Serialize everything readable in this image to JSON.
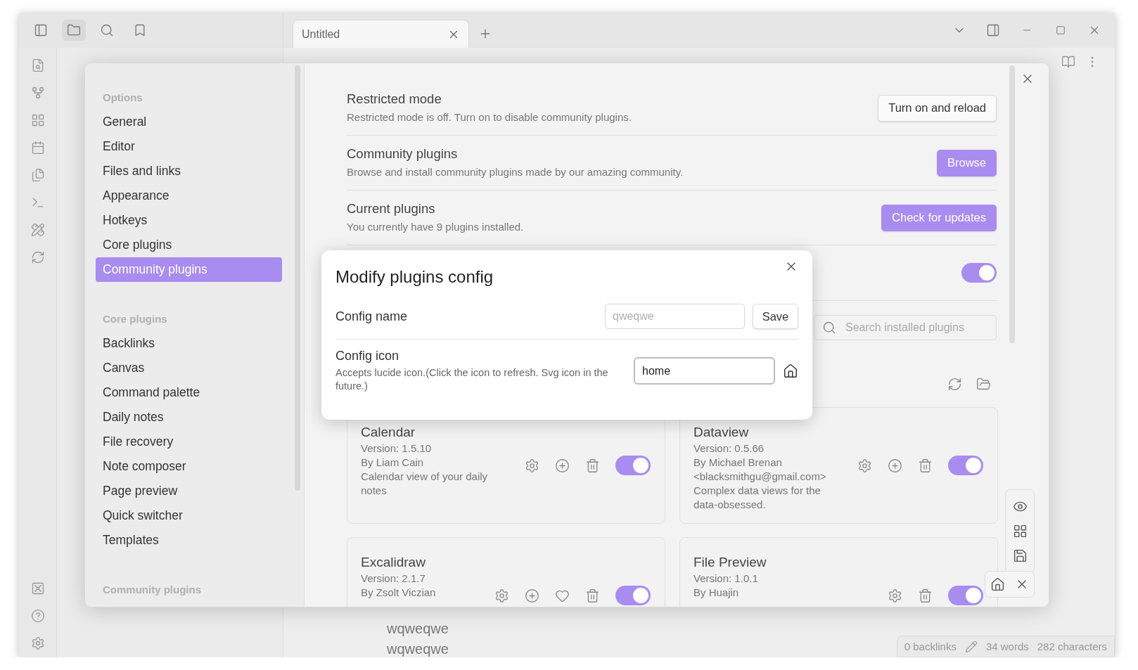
{
  "title_bar": {
    "tabs": [
      {
        "label": "Untitled",
        "selected": true
      }
    ]
  },
  "settings": {
    "nav": [
      {
        "heading": "Options",
        "items": [
          {
            "label": "General",
            "selected": false
          },
          {
            "label": "Editor",
            "selected": false
          },
          {
            "label": "Files and links",
            "selected": false
          },
          {
            "label": "Appearance",
            "selected": false
          },
          {
            "label": "Hotkeys",
            "selected": false
          },
          {
            "label": "Core plugins",
            "selected": false
          },
          {
            "label": "Community plugins",
            "selected": true
          }
        ]
      },
      {
        "heading": "Core plugins",
        "items": [
          {
            "label": "Backlinks",
            "selected": false
          },
          {
            "label": "Canvas",
            "selected": false
          },
          {
            "label": "Command palette",
            "selected": false
          },
          {
            "label": "Daily notes",
            "selected": false
          },
          {
            "label": "File recovery",
            "selected": false
          },
          {
            "label": "Note composer",
            "selected": false
          },
          {
            "label": "Page preview",
            "selected": false
          },
          {
            "label": "Quick switcher",
            "selected": false
          },
          {
            "label": "Templates",
            "selected": false
          }
        ]
      },
      {
        "heading": "Community plugins"
      }
    ],
    "sections": [
      {
        "title": "Restricted mode",
        "description": "Restricted mode is off. Turn on to disable community plugins.",
        "button": {
          "label": "Turn on and reload",
          "kind": "default"
        }
      },
      {
        "title": "Community plugins",
        "description": "Browse and install community plugins made by our amazing community.",
        "button": {
          "label": "Browse",
          "kind": "accent"
        }
      },
      {
        "title": "Current plugins",
        "description": "You currently have 9 plugins installed.",
        "button": {
          "label": "Check for updates",
          "kind": "accent"
        }
      }
    ],
    "master_toggle": {
      "on": true
    },
    "search": {
      "placeholder": "Search installed plugins"
    },
    "plugins": [
      {
        "name": "Calendar",
        "version": "Version: 1.5.10",
        "author": "By Liam Cain",
        "description": "Calendar view of your daily notes",
        "actions": [
          {
            "kind": "settings"
          },
          {
            "kind": "add"
          },
          {
            "kind": "delete"
          }
        ],
        "enabled": true
      },
      {
        "name": "Dataview",
        "version": "Version: 0.5.66",
        "author": "By Michael Brenan <blacksmithgu@gmail.com>",
        "description": "Complex data views for the data-obsessed.",
        "actions": [
          {
            "kind": "settings"
          },
          {
            "kind": "add"
          },
          {
            "kind": "delete"
          }
        ],
        "enabled": true
      },
      {
        "name": "Excalidraw",
        "version": "Version: 2.1.7",
        "author": "By Zsolt Viczian",
        "actions": [
          {
            "kind": "settings"
          },
          {
            "kind": "add"
          },
          {
            "kind": "like"
          },
          {
            "kind": "delete"
          }
        ],
        "enabled": true
      },
      {
        "name": "File Preview",
        "version": "Version: 1.0.1",
        "author": "By Huajin",
        "actions": [
          {
            "kind": "settings"
          },
          {
            "kind": "delete"
          }
        ],
        "enabled": true
      }
    ]
  },
  "dialog": {
    "title": "Modify plugins config",
    "name_label": "Config name",
    "name_field": {
      "placeholder": "qweqwe"
    },
    "save_button": "Save",
    "icon_label": "Config icon",
    "icon_help": "Accepts lucide icon.(Click the icon to refresh. Svg icon in the future.)",
    "icon_field": {
      "value": "home"
    }
  },
  "editor": {
    "lines": [
      "wqweqwe",
      "wqweqwe"
    ]
  },
  "status_bar": {
    "backlinks": "0 backlinks",
    "words": "34 words",
    "characters": "282 characters"
  }
}
